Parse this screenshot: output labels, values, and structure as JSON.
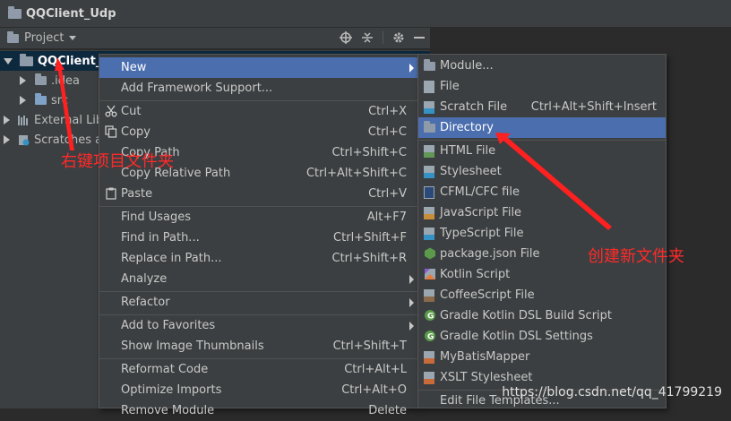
{
  "window": {
    "title": "QQClient_Udp"
  },
  "project_panel": {
    "label": "Project"
  },
  "tree": [
    {
      "label": "QQClient_U",
      "expanded": true,
      "selected": true
    },
    {
      "label": ".idea"
    },
    {
      "label": "src"
    },
    {
      "label": "External Libr"
    },
    {
      "label": "Scratches a"
    }
  ],
  "context_menu": {
    "items": [
      {
        "label": "New",
        "shortcut": "",
        "submenu": true,
        "selected": true
      },
      {
        "label": "Add Framework Support...",
        "shortcut": ""
      },
      {
        "label": "Cut",
        "shortcut": "Ctrl+X",
        "icon": "scissors-icon"
      },
      {
        "label": "Copy",
        "shortcut": "Ctrl+C",
        "icon": "copy-icon"
      },
      {
        "label": "Copy Path",
        "shortcut": "Ctrl+Shift+C"
      },
      {
        "label": "Copy Relative Path",
        "shortcut": "Ctrl+Alt+Shift+C"
      },
      {
        "label": "Paste",
        "shortcut": "Ctrl+V",
        "icon": "paste-icon"
      },
      {
        "label": "Find Usages",
        "shortcut": "Alt+F7"
      },
      {
        "label": "Find in Path...",
        "shortcut": "Ctrl+Shift+F"
      },
      {
        "label": "Replace in Path...",
        "shortcut": "Ctrl+Shift+R"
      },
      {
        "label": "Analyze",
        "shortcut": "",
        "submenu": true
      },
      {
        "label": "Refactor",
        "shortcut": "",
        "submenu": true
      },
      {
        "label": "Add to Favorites",
        "shortcut": "",
        "submenu": true
      },
      {
        "label": "Show Image Thumbnails",
        "shortcut": "Ctrl+Shift+T"
      },
      {
        "label": "Reformat Code",
        "shortcut": "Ctrl+Alt+L"
      },
      {
        "label": "Optimize Imports",
        "shortcut": "Ctrl+Alt+O"
      },
      {
        "label": "Remove Module",
        "shortcut": "Delete"
      }
    ]
  },
  "new_submenu": {
    "items": [
      {
        "label": "Module...",
        "shortcut": "",
        "icon": "module-icon"
      },
      {
        "label": "File",
        "shortcut": "",
        "icon": "file-icon"
      },
      {
        "label": "Scratch File",
        "shortcut": "Ctrl+Alt+Shift+Insert",
        "icon": "scratch-file-icon"
      },
      {
        "label": "Directory",
        "shortcut": "",
        "icon": "folder-icon",
        "selected": true
      },
      {
        "label": "HTML File",
        "icon": "html-file-icon"
      },
      {
        "label": "Stylesheet",
        "icon": "css-file-icon"
      },
      {
        "label": "CFML/CFC file",
        "icon": "cfml-file-icon"
      },
      {
        "label": "JavaScript File",
        "icon": "js-file-icon"
      },
      {
        "label": "TypeScript File",
        "icon": "ts-file-icon"
      },
      {
        "label": "package.json File",
        "icon": "nodejs-icon"
      },
      {
        "label": "Kotlin Script",
        "icon": "kotlin-icon"
      },
      {
        "label": "CoffeeScript File",
        "icon": "coffeescript-icon"
      },
      {
        "label": "Gradle Kotlin DSL Build Script",
        "icon": "gradle-icon"
      },
      {
        "label": "Gradle Kotlin DSL Settings",
        "icon": "gradle-icon"
      },
      {
        "label": "MyBatisMapper",
        "icon": "xml-file-icon"
      },
      {
        "label": "XSLT Stylesheet",
        "icon": "xml-file-icon"
      },
      {
        "label": "Edit File Templates...",
        "icon": ""
      }
    ]
  },
  "annotations": {
    "right_click_note": "右键项目文件夹",
    "create_folder_note": "创建新文件夹"
  },
  "watermark": "https://blog.csdn.net/qq_41799219",
  "colors": {
    "menu_bg": "#3c3f41",
    "selection": "#4b6eaf",
    "annotation": "#ff2a2a"
  }
}
